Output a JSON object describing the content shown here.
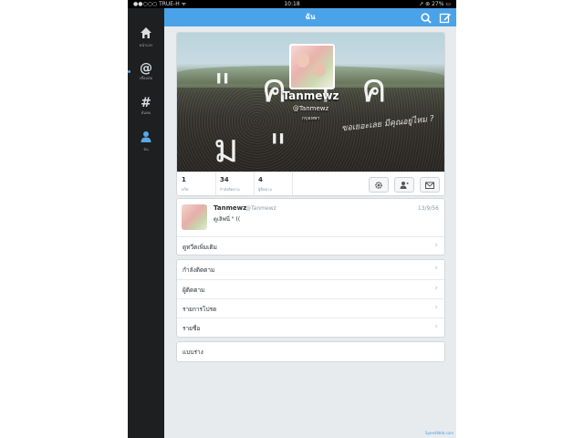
{
  "status": {
    "carrier": "●●○○○ TRUE-H ᯤ",
    "time": "10:18",
    "battery": "↗ ⊛ 27% ▭"
  },
  "topbar": {
    "title": "ฉัน",
    "search_icon": "search-icon",
    "compose_icon": "compose-icon"
  },
  "sidebar": {
    "items": [
      {
        "label": "หน้าแรก",
        "icon": "home-icon"
      },
      {
        "label": "เชื่อมต่อ",
        "icon": "at-icon"
      },
      {
        "label": "ค้นพบ",
        "icon": "hashtag-icon"
      },
      {
        "label": "ฉัน",
        "icon": "person-icon"
      }
    ]
  },
  "profile": {
    "name": "Tanmewz",
    "handle": "@Tanmewz",
    "location": "กรุงเทพฯ",
    "banner_text": "\" ค ำ ค ม \"",
    "banner_deco": "ขอเยอะเลย มีคุณอยู่ไหม ?"
  },
  "stats": [
    {
      "num": "1",
      "label": "ทวีต"
    },
    {
      "num": "34",
      "label": "กำลังติดตาม"
    },
    {
      "num": "4",
      "label": "ผู้ติดตาม"
    }
  ],
  "tweet": {
    "name": "Tanmewz",
    "handle": "@Tanmewz",
    "date": "13/9/56",
    "text": "ดูเลิฟนี่ \" (("
  },
  "links": {
    "more_tweets": "ดูทวีตเพิ่มเติม",
    "following": "กำลังติดตาม",
    "followers": "ผู้ติดตาม",
    "favorites": "รายการโปรด",
    "lists": "รายชื่อ",
    "drafts": "แบบร่าง"
  },
  "colors": {
    "accent": "#4aa3e8",
    "sidebar": "#1d1f21",
    "background": "#e8ebee"
  },
  "watermark": "SpeedWeb.com"
}
